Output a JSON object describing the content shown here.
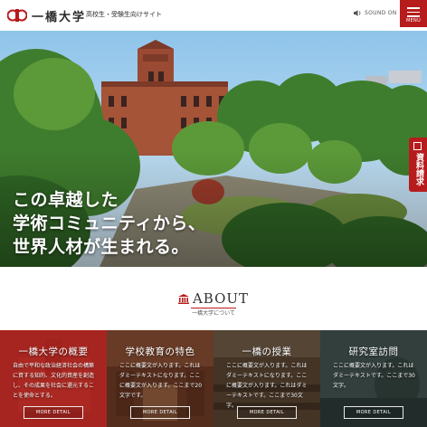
{
  "header": {
    "logo_text": "一橋大学",
    "logo_sub": "高校生・受験生向けサイト",
    "sound_label": "SOUND ON",
    "menu_label": "MENU"
  },
  "hero": {
    "catch_lines": [
      "この卓越した",
      "学術コミュニティから、",
      "世界人材が生まれる。"
    ],
    "doc_request_label": "資料請求"
  },
  "about": {
    "title": "ABOUT",
    "subtitle": "一橋大学について"
  },
  "cards": [
    {
      "title": "一橋大学の概要",
      "body": "自由で平和な政治経済社会の構築に資する知的、文化的資産を創造し、その成果を社会に還元することを使命とする。",
      "button": "MORE DETAIL"
    },
    {
      "title": "学校教育の特色",
      "body": "ここに概要文が入ります。これはダミーテキストになります。ここに概要文が入ります。ここまで20文字です。",
      "button": "MORE DETAIL"
    },
    {
      "title": "一橋の授業",
      "body": "ここに概要文が入ります。これはダミーテキストになります。ここに概要文が入ります。これはダミーテキストです。ここまで30文字。",
      "button": "MORE DETAIL"
    },
    {
      "title": "研究室訪問",
      "body": "ここに概要文が入ります。これはダミーテキストです。ここまで30文字。",
      "button": "MORE DETAIL"
    }
  ],
  "colors": {
    "accent": "#b71c1c"
  }
}
